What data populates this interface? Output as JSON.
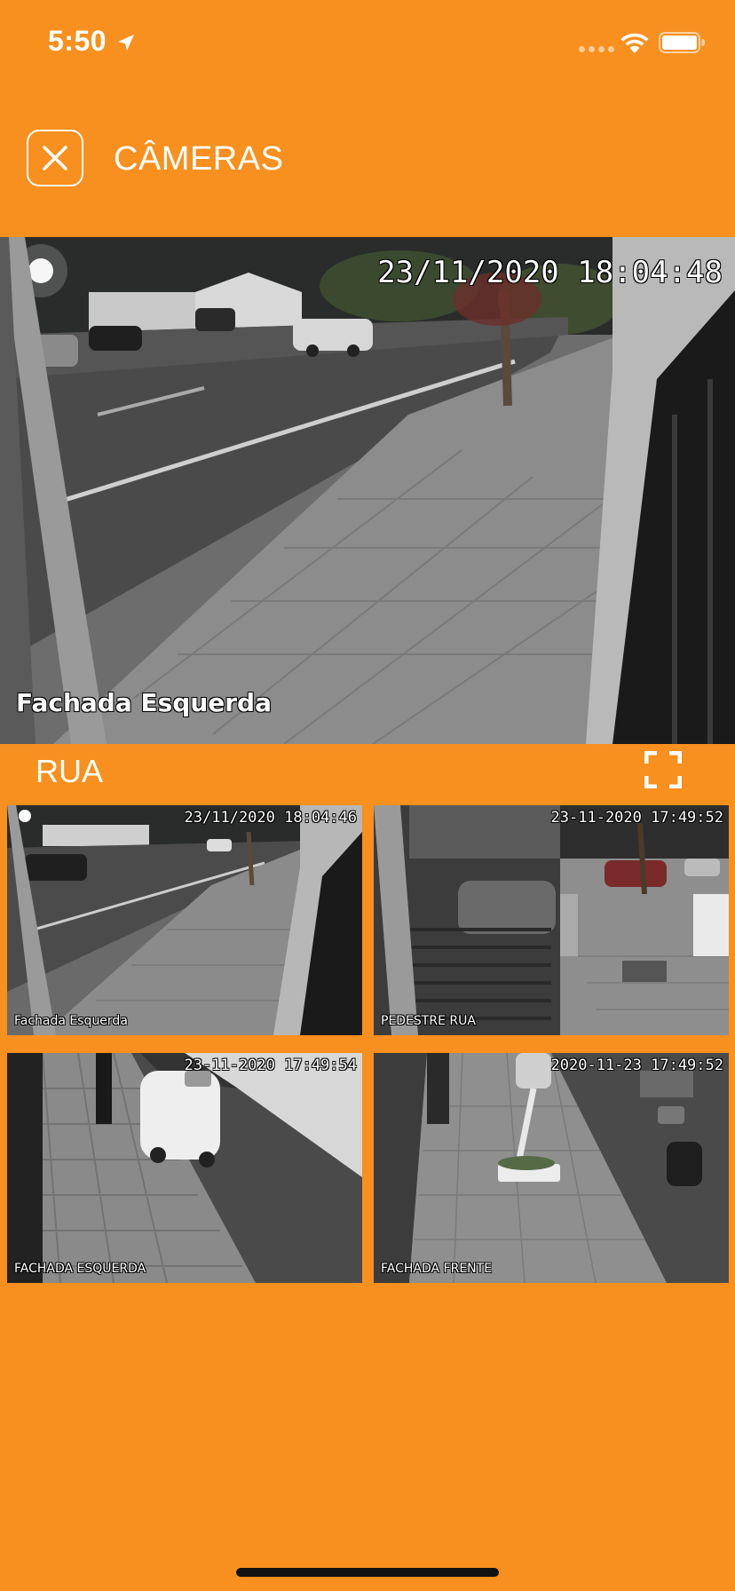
{
  "status_bar": {
    "time": "5:50",
    "icons": [
      "location-arrow-icon",
      "signal-icon",
      "wifi-icon",
      "battery-icon"
    ]
  },
  "header": {
    "title": "CÂMERAS",
    "close_icon": "close-icon"
  },
  "main_feed": {
    "timestamp": "23/11/2020 18:04:48",
    "camera_name": "Fachada Esquerda"
  },
  "group": {
    "label": "RUA",
    "fullscreen_icon": "fullscreen-icon"
  },
  "thumbnails": [
    {
      "timestamp": "23/11/2020 18:04:46",
      "camera_name": "Fachada Esquerda"
    },
    {
      "timestamp": "23-11-2020 17:49:52",
      "camera_name": "PEDESTRE RUA"
    },
    {
      "timestamp": "23-11-2020 17:49:54",
      "camera_name": "FACHADA ESQUERDA"
    },
    {
      "timestamp": "2020-11-23 17:49:52",
      "camera_name": "FACHADA FRENTE"
    }
  ],
  "colors": {
    "background": "#F7901E",
    "text": "#FFFFFF",
    "home_indicator": "#111111"
  }
}
